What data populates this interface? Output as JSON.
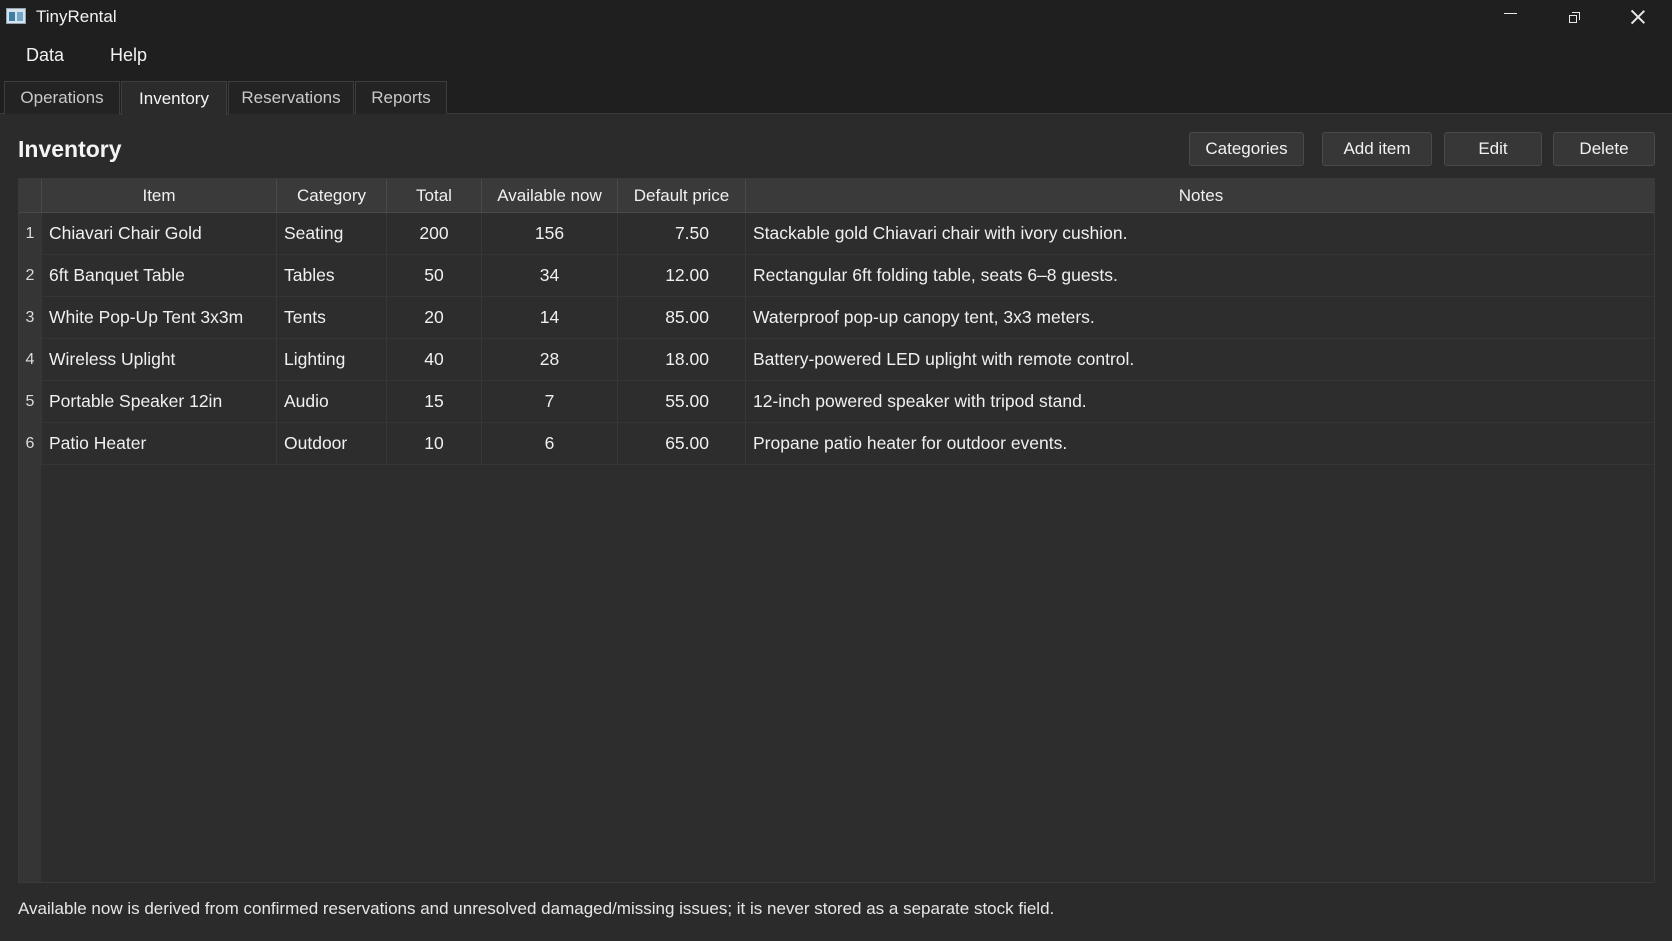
{
  "window": {
    "title": "TinyRental",
    "controls": {
      "minimize": "minimize",
      "maximize": "restore",
      "close": "close"
    }
  },
  "menu": {
    "items": [
      "Data",
      "Help"
    ]
  },
  "tabs": [
    {
      "label": "Operations",
      "active": false
    },
    {
      "label": "Inventory",
      "active": true
    },
    {
      "label": "Reservations",
      "active": false
    },
    {
      "label": "Reports",
      "active": false
    }
  ],
  "page": {
    "title": "Inventory",
    "buttons": {
      "categories": "Categories",
      "add": "Add item",
      "edit": "Edit",
      "delete": "Delete"
    }
  },
  "table": {
    "headers": [
      "Item",
      "Category",
      "Total",
      "Available now",
      "Default price",
      "Notes"
    ],
    "rows": [
      {
        "n": "1",
        "item": "Chiavari Chair Gold",
        "category": "Seating",
        "total": "200",
        "available": "156",
        "price": "7.50",
        "notes": "Stackable gold Chiavari chair with ivory cushion."
      },
      {
        "n": "2",
        "item": "6ft Banquet Table",
        "category": "Tables",
        "total": "50",
        "available": "34",
        "price": "12.00",
        "notes": "Rectangular 6ft folding table, seats 6–8 guests."
      },
      {
        "n": "3",
        "item": "White Pop-Up Tent 3x3m",
        "category": "Tents",
        "total": "20",
        "available": "14",
        "price": "85.00",
        "notes": "Waterproof pop-up canopy tent, 3x3 meters."
      },
      {
        "n": "4",
        "item": "Wireless Uplight",
        "category": "Lighting",
        "total": "40",
        "available": "28",
        "price": "18.00",
        "notes": "Battery-powered LED uplight with remote control."
      },
      {
        "n": "5",
        "item": "Portable Speaker 12in",
        "category": "Audio",
        "total": "15",
        "available": "7",
        "price": "55.00",
        "notes": "12-inch powered speaker with tripod stand."
      },
      {
        "n": "6",
        "item": "Patio Heater",
        "category": "Outdoor",
        "total": "10",
        "available": "6",
        "price": "65.00",
        "notes": "Propane patio heater for outdoor events."
      }
    ]
  },
  "footer": {
    "note": "Available now is derived from confirmed reservations and unresolved damaged/missing issues; it is never stored as a separate stock field."
  }
}
